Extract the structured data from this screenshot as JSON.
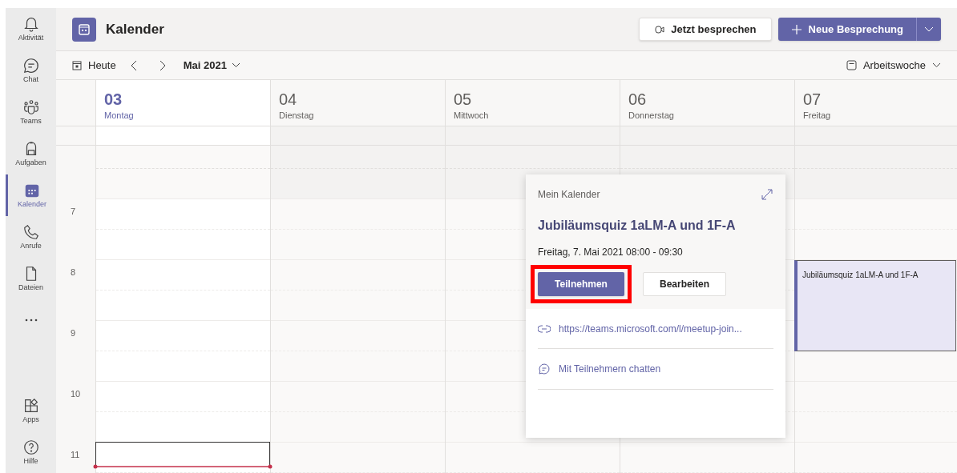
{
  "rail": {
    "items": [
      {
        "label": "Aktivität",
        "kind": "bell",
        "selected": false
      },
      {
        "label": "Chat",
        "kind": "chat",
        "selected": false
      },
      {
        "label": "Teams",
        "kind": "teams",
        "selected": false
      },
      {
        "label": "Aufgaben",
        "kind": "bag",
        "selected": false
      },
      {
        "label": "Kalender",
        "kind": "calendar",
        "selected": true
      },
      {
        "label": "Anrufe",
        "kind": "phone",
        "selected": false
      },
      {
        "label": "Dateien",
        "kind": "file",
        "selected": false
      },
      {
        "kind": "more",
        "selected": false
      }
    ],
    "bottom": [
      {
        "label": "Apps",
        "kind": "apps"
      },
      {
        "label": "Hilfe",
        "kind": "help"
      }
    ]
  },
  "header": {
    "title": "Kalender",
    "meet_now": "Jetzt besprechen",
    "new_meeting": "Neue Besprechung"
  },
  "toolbar": {
    "today": "Heute",
    "month": "Mai 2021",
    "view": "Arbeitswoche"
  },
  "days": [
    {
      "number": "03",
      "weekday": "Montag",
      "selected": true
    },
    {
      "number": "04",
      "weekday": "Dienstag",
      "selected": false
    },
    {
      "number": "05",
      "weekday": "Mittwoch",
      "selected": false
    },
    {
      "number": "06",
      "weekday": "Donnerstag",
      "selected": false
    },
    {
      "number": "07",
      "weekday": "Freitag",
      "selected": false
    }
  ],
  "hours": [
    "7",
    "8",
    "9",
    "10",
    "11"
  ],
  "event": {
    "title": "Jubiläumsquiz 1aLM-A und 1F-A"
  },
  "popup": {
    "calendar": "Mein Kalender",
    "title": "Jubiläumsquiz 1aLM-A und 1F-A",
    "time": "Freitag, 7. Mai 2021 08:00 - 09:30",
    "join": {
      "label": "Teilnehmen",
      "highlighted": true
    },
    "edit": "Bearbeiten",
    "link": "https://teams.microsoft.com/l/meetup-join...",
    "chat": "Mit Teilnehmern chatten"
  }
}
